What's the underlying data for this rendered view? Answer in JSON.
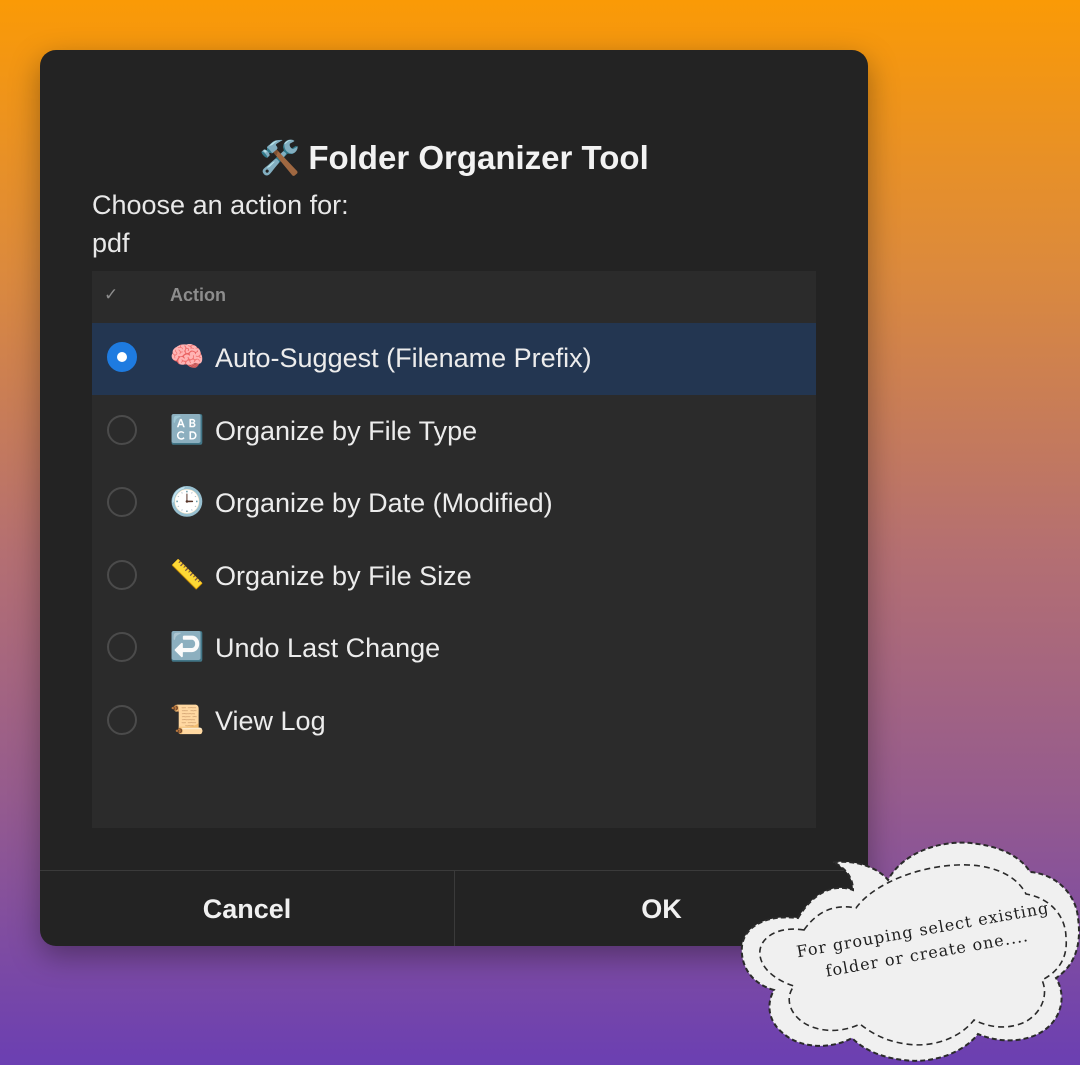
{
  "dialog": {
    "title_icon": "🛠️",
    "title": "Folder Organizer Tool",
    "prompt_line1": "Choose an action for:",
    "prompt_line2": "pdf"
  },
  "list": {
    "header_check": "✓",
    "header_action": "Action",
    "selected_index": 0,
    "items": [
      {
        "icon": "🧠",
        "icon_name": "brain-icon",
        "label": "Auto-Suggest (Filename Prefix)"
      },
      {
        "icon": "🔠",
        "icon_name": "abcd-letters-icon",
        "label": "Organize by File Type"
      },
      {
        "icon": "🕒",
        "icon_name": "clock-icon",
        "label": "Organize by Date (Modified)"
      },
      {
        "icon": "📏",
        "icon_name": "ruler-icon",
        "label": "Organize by File Size"
      },
      {
        "icon": "↩️",
        "icon_name": "undo-arrow-icon",
        "label": "Undo Last Change"
      },
      {
        "icon": "📜",
        "icon_name": "scroll-icon",
        "label": "View Log"
      }
    ]
  },
  "buttons": {
    "cancel": "Cancel",
    "ok": "OK"
  },
  "annotation": {
    "line1": "For grouping select existing",
    "line2": "folder or create one...."
  },
  "colors": {
    "selected_row": "#233651",
    "radio_accent": "#1e7be0",
    "dialog_bg": "#232323"
  }
}
